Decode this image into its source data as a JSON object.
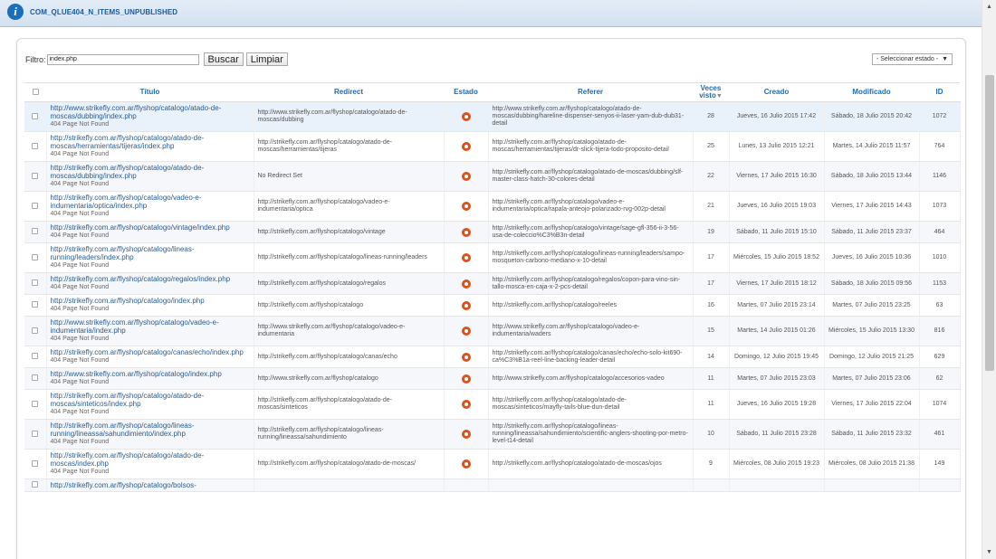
{
  "info": {
    "message": "COM_QLUE404_N_ITEMS_UNPUBLISHED"
  },
  "filter": {
    "label": "Filtro:",
    "value": "index.php",
    "search_label": "Buscar",
    "clear_label": "Limpiar"
  },
  "state_select": {
    "selected": "- Seleccionar estado -"
  },
  "columns": {
    "title": "Título",
    "redirect": "Redirect",
    "status": "Estado",
    "referer": "Referer",
    "hits_line1": "Veces",
    "hits_line2": "visto",
    "created": "Creado",
    "modified": "Modificado",
    "id": "ID"
  },
  "rows": [
    {
      "url": "http://www.strikefly.com.ar/flyshop/catalogo/atado-de-moscas/dubbing/index.php",
      "note": "404 Page Not Found",
      "redirect": "http://www.strikefly.com.ar/flyshop/catalogo/atado-de-moscas/dubbing",
      "referer": "http://www.strikefly.com.ar/flyshop/catalogo/atado-de-moscas/dubbing/hareline-dispenser-senyos-ii-laser-yam-dub-dub31-detail",
      "hits": "28",
      "created": "Jueves, 16 Julio 2015 17:42",
      "modified": "Sábado, 18 Julio 2015 20:42",
      "id": "1072"
    },
    {
      "url": "http://strikefly.com.ar/flyshop/catalogo/atado-de-moscas/herramientas/tijeras/index.php",
      "note": "404 Page Not Found",
      "redirect": "http://strikefly.com.ar/flyshop/catalogo/atado-de-moscas/herramientas/tijeras",
      "referer": "http://strikefly.com.ar/flyshop/catalogo/atado-de-moscas/herramientas/tijeras/dr-slick-tijera-todo-proposito-detail",
      "hits": "25",
      "created": "Lunes, 13 Julio 2015 12:21",
      "modified": "Martes, 14 Julio 2015 11:57",
      "id": "764"
    },
    {
      "url": "http://strikefly.com.ar/flyshop/catalogo/atado-de-moscas/dubbing/index.php",
      "note": "404 Page Not Found",
      "redirect": "No Redirect Set",
      "referer": "http://strikefly.com.ar/flyshop/catalogo/atado-de-moscas/dubbing/slf-master-class-hatch-30-colores-detail",
      "hits": "22",
      "created": "Viernes, 17 Julio 2015 16:30",
      "modified": "Sábado, 18 Julio 2015 13:44",
      "id": "1146"
    },
    {
      "url": "http://strikefly.com.ar/flyshop/catalogo/vadeo-e-indumentaria/optica/index.php",
      "note": "404 Page Not Found",
      "redirect": "http://strikefly.com.ar/flyshop/catalogo/vadeo-e-indumentaria/optica",
      "referer": "http://strikefly.com.ar/flyshop/catalogo/vadeo-e-indumentaria/optica/rapala-anteojo-polarizado-rvg-002p-detail",
      "hits": "21",
      "created": "Jueves, 16 Julio 2015 19:03",
      "modified": "Viernes, 17 Julio 2015 14:43",
      "id": "1073"
    },
    {
      "url": "http://strikefly.com.ar/flyshop/catalogo/vintage/index.php",
      "note": "404 Page Not Found",
      "redirect": "http://strikefly.com.ar/flyshop/catalogo/vintage",
      "referer": "http://strikefly.com.ar/flyshop/catalogo/vintage/sage-gfl-356-ii-3-56-usa-de-coleccio%C3%B3n-detail",
      "hits": "19",
      "created": "Sábado, 11 Julio 2015 15:10",
      "modified": "Sábado, 11 Julio 2015 23:37",
      "id": "464"
    },
    {
      "url": "http://strikefly.com.ar/flyshop/catalogo/lineas-running/leaders/index.php",
      "note": "404 Page Not Found",
      "redirect": "http://strikefly.com.ar/flyshop/catalogo/lineas-running/leaders",
      "referer": "http://strikefly.com.ar/flyshop/catalogo/lineas-running/leaders/sampo-mosqueton-carbono-mediano-x-10-detail",
      "hits": "17",
      "created": "Miércoles, 15 Julio 2015 18:52",
      "modified": "Jueves, 16 Julio 2015 10:36",
      "id": "1010"
    },
    {
      "url": "http://strikefly.com.ar/flyshop/catalogo/regalos/index.php",
      "note": "404 Page Not Found",
      "redirect": "http://strikefly.com.ar/flyshop/catalogo/regalos",
      "referer": "http://strikefly.com.ar/flyshop/catalogo/regalos/copon-para-vino-sin-tallo-mosca-en-caja-x-2-pcs-detail",
      "hits": "17",
      "created": "Viernes, 17 Julio 2015 18:12",
      "modified": "Sábado, 18 Julio 2015 09:56",
      "id": "1153"
    },
    {
      "url": "http://strikefly.com.ar/flyshop/catalogo/index.php",
      "note": "404 Page Not Found",
      "redirect": "http://strikefly.com.ar/flyshop/catalogo",
      "referer": "http://strikefly.com.ar/flyshop/catalogo/reeles",
      "hits": "16",
      "created": "Martes, 07 Julio 2015 23:14",
      "modified": "Martes, 07 Julio 2015 23:25",
      "id": "63"
    },
    {
      "url": "http://www.strikefly.com.ar/flyshop/catalogo/vadeo-e-indumentaria/index.php",
      "note": "404 Page Not Found",
      "redirect": "http://www.strikefly.com.ar/flyshop/catalogo/vadeo-e-indumentaria",
      "referer": "http://www.strikefly.com.ar/flyshop/catalogo/vadeo-e-indumentaria/waders",
      "hits": "15",
      "created": "Martes, 14 Julio 2015 01:26",
      "modified": "Miércoles, 15 Julio 2015 13:30",
      "id": "816"
    },
    {
      "url": "http://strikefly.com.ar/flyshop/catalogo/canas/echo/index.php",
      "note": "404 Page Not Found",
      "redirect": "http://strikefly.com.ar/flyshop/catalogo/canas/echo",
      "referer": "http://strikefly.com.ar/flyshop/catalogo/canas/echo/echo-solo-kit690-ca%C3%B1a-reel-line-backing-leader-detail",
      "hits": "14",
      "created": "Domingo, 12 Julio 2015 19:45",
      "modified": "Domingo, 12 Julio 2015 21:25",
      "id": "629"
    },
    {
      "url": "http://www.strikefly.com.ar/flyshop/catalogo/index.php",
      "note": "404 Page Not Found",
      "redirect": "http://www.strikefly.com.ar/flyshop/catalogo",
      "referer": "http://www.strikefly.com.ar/flyshop/catalogo/accesorios-vadeo",
      "hits": "11",
      "created": "Martes, 07 Julio 2015 23:03",
      "modified": "Martes, 07 Julio 2015 23:06",
      "id": "62"
    },
    {
      "url": "http://strikefly.com.ar/flyshop/catalogo/atado-de-moscas/sinteticos/index.php",
      "note": "404 Page Not Found",
      "redirect": "http://strikefly.com.ar/flyshop/catalogo/atado-de-moscas/sinteticos",
      "referer": "http://strikefly.com.ar/flyshop/catalogo/atado-de-moscas/sinteticos/mayfly-tails-blue-dun-detail",
      "hits": "11",
      "created": "Jueves, 16 Julio 2015 19:28",
      "modified": "Viernes, 17 Julio 2015 22:04",
      "id": "1074"
    },
    {
      "url": "http://strikefly.com.ar/flyshop/catalogo/lineas-running/lineassa/sahundimiento/index.php",
      "note": "404 Page Not Found",
      "redirect": "http://strikefly.com.ar/flyshop/catalogo/lineas-running/lineassa/sahundimiento",
      "referer": "http://strikefly.com.ar/flyshop/catalogo/lineas-running/lineassa/sahundimiento/scientific-anglers-shooting-por-metro-level-t14-detail",
      "hits": "10",
      "created": "Sábado, 11 Julio 2015 23:28",
      "modified": "Sábado, 11 Julio 2015 23:32",
      "id": "461"
    },
    {
      "url": "http://strikefly.com.ar/flyshop/catalogo/atado-de-moscas/index.php",
      "note": "404 Page Not Found",
      "redirect": "http://strikefly.com.ar/flyshop/catalogo/atado-de-moscas/",
      "referer": "http://strikefly.com.ar/flyshop/catalogo/atado-de-moscas/ojos",
      "hits": "9",
      "created": "Miércoles, 08 Julio 2015 19:23",
      "modified": "Miércoles, 08 Julio 2015 21:38",
      "id": "149"
    },
    {
      "url": "http://strikefly.com.ar/flyshop/catalogo/bolsos-",
      "note": "",
      "redirect": "",
      "referer": "",
      "hits": "",
      "created": "",
      "modified": "",
      "id": ""
    }
  ]
}
